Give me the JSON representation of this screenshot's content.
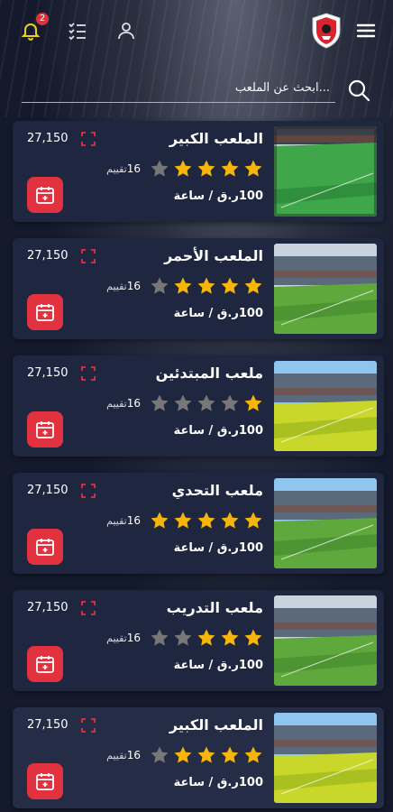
{
  "header": {
    "notification_count": "2",
    "icons": [
      "bell-icon",
      "checklist-icon",
      "user-icon",
      "club-logo",
      "menu-icon"
    ]
  },
  "search": {
    "placeholder": "...ابحث عن الملعب"
  },
  "colors": {
    "accent": "#e3323f",
    "star_on": "#f5b50a",
    "star_off": "#777777",
    "bell": "#e8d11a"
  },
  "fields": [
    {
      "name": "الملعب الكبير",
      "stars": 4,
      "ratings": "16",
      "ratings_label": "تقييم",
      "price": "100ر.ق / ساعة",
      "count": "27,150",
      "theme": "green"
    },
    {
      "name": "الملعب الأحمر",
      "stars": 4,
      "ratings": "16",
      "ratings_label": "تقييم",
      "price": "100ر.ق / ساعة",
      "count": "27,150",
      "theme": "stadium"
    },
    {
      "name": "ملعب المبتدئين",
      "stars": 1,
      "ratings": "16",
      "ratings_label": "تقييم",
      "price": "100ر.ق / ساعة",
      "count": "27,150",
      "theme": "yellow"
    },
    {
      "name": "ملعب التحدي",
      "stars": 5,
      "ratings": "16",
      "ratings_label": "تقييم",
      "price": "100ر.ق / ساعة",
      "count": "27,150",
      "theme": "sunny"
    },
    {
      "name": "ملعب التدريب",
      "stars": 3,
      "ratings": "16",
      "ratings_label": "تقييم",
      "price": "100ر.ق / ساعة",
      "count": "27,150",
      "theme": "stadium"
    },
    {
      "name": "الملعب الكبير",
      "stars": 4,
      "ratings": "16",
      "ratings_label": "تقييم",
      "price": "100ر.ق / ساعة",
      "count": "27,150",
      "theme": "yellow"
    }
  ]
}
